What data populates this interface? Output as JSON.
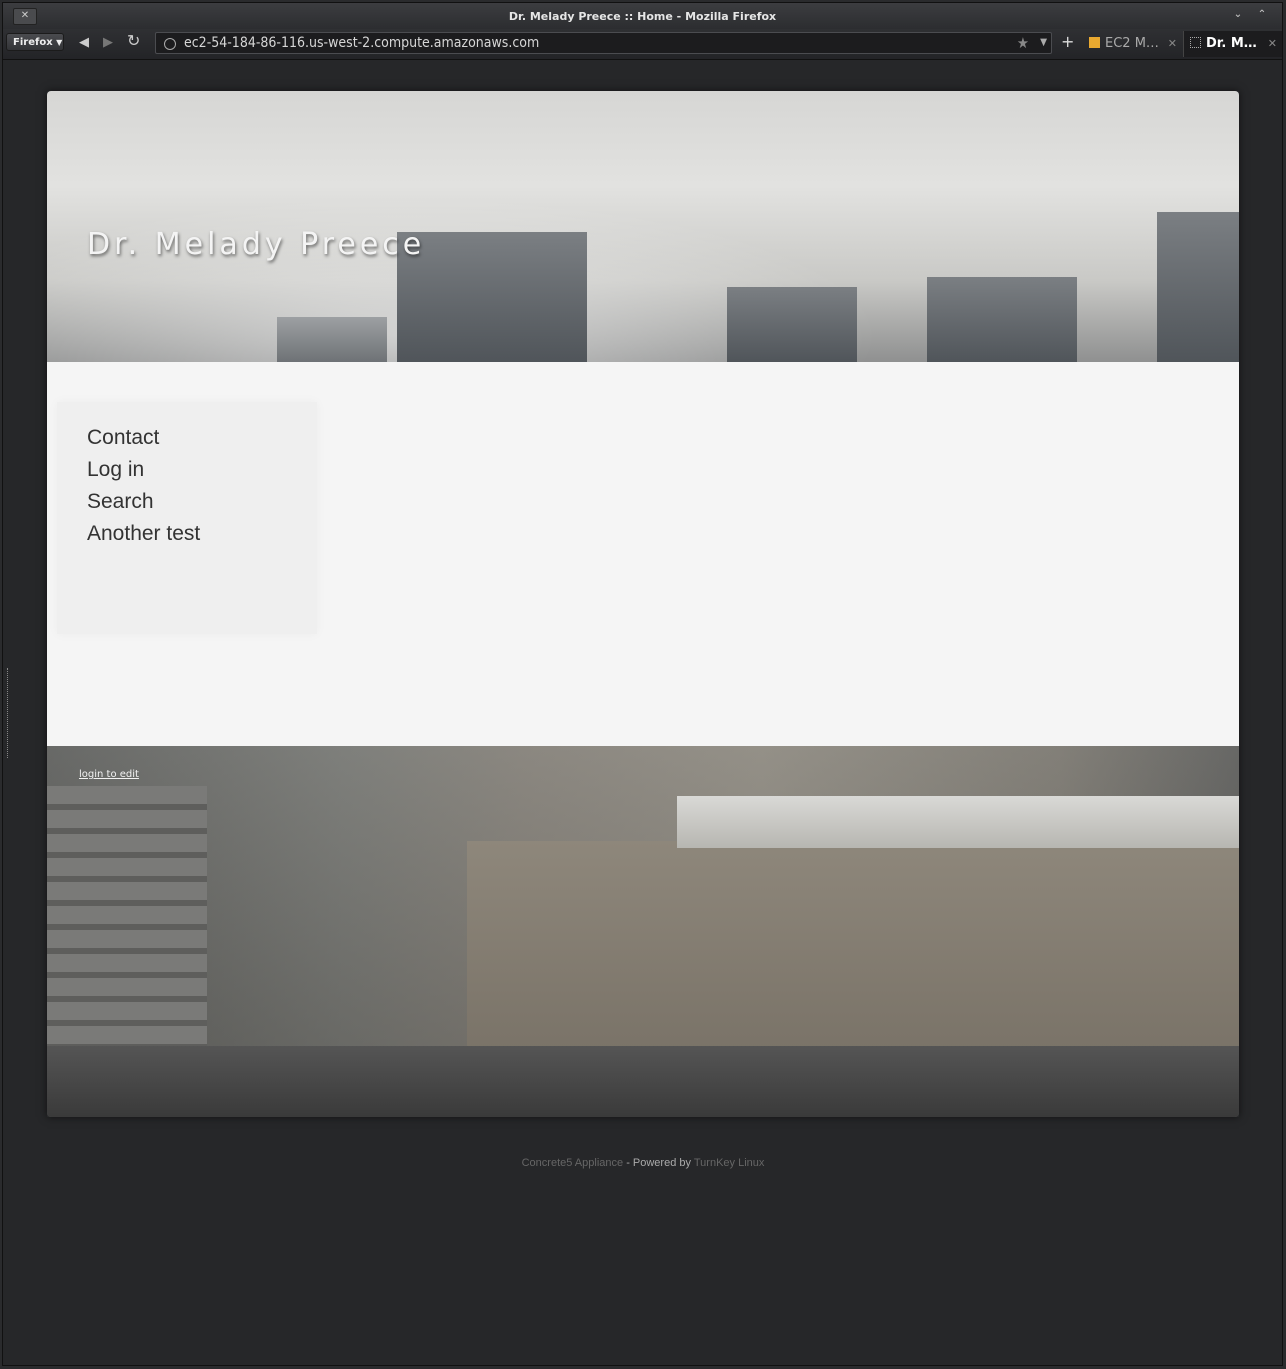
{
  "window": {
    "title": "Dr. Melady Preece :: Home - Mozilla Firefox",
    "close_label": "✕"
  },
  "toolbar": {
    "firefox_menu_label": "Firefox",
    "url": "ec2-54-184-86-116.us-west-2.compute.amazonaws.com",
    "new_tab_label": "+"
  },
  "tabs": [
    {
      "label": "EC2 M…",
      "active": false
    },
    {
      "label": "Dr. M…",
      "active": true
    }
  ],
  "site": {
    "title": "Dr. Melady Preece",
    "nav": [
      "Contact",
      "Log in",
      "Search",
      "Another test"
    ],
    "login_link": "login to edit"
  },
  "footer": {
    "appliance": "Concrete5 Appliance",
    "separator": "- Powered by",
    "vendor": "TurnKey Linux"
  },
  "colors": {
    "background": "#2a2b2d",
    "content": "#f5f5f5",
    "title_text": "#f4f4f4"
  }
}
